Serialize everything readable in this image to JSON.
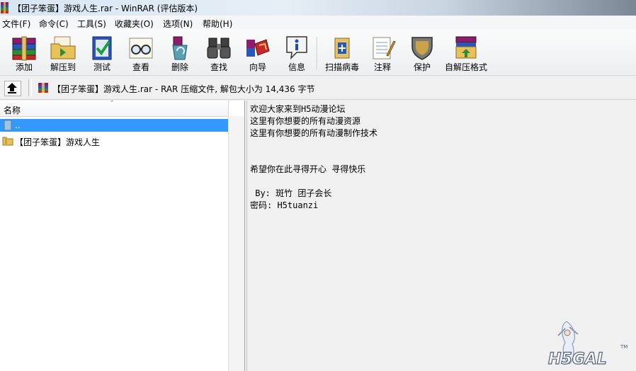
{
  "window": {
    "title": "【团子笨蛋】游戏人生.rar - WinRAR (评估版本)"
  },
  "menu": [
    "文件(F)",
    "命令(C)",
    "工具(S)",
    "收藏夹(O)",
    "选项(N)",
    "帮助(H)"
  ],
  "toolbar": {
    "add": "添加",
    "extract_to": "解压到",
    "test": "测试",
    "view": "查看",
    "delete": "删除",
    "find": "查找",
    "wizard": "向导",
    "info": "信息",
    "virus_scan": "扫描病毒",
    "comment": "注释",
    "protect": "保护",
    "sfx": "自解压格式"
  },
  "address": {
    "text": "【团子笨蛋】游戏人生.rar - RAR 压缩文件, 解包大小为 14,436 字节"
  },
  "file_list": {
    "column_name": "名称",
    "sort_indicator": "˄",
    "rows": [
      {
        "name": "..",
        "selected": true
      },
      {
        "name": "【团子笨蛋】游戏人生",
        "selected": false
      }
    ]
  },
  "comment": {
    "lines": [
      "欢迎大家来到H5动漫论坛",
      "这里有你想要的所有动漫资源",
      "这里有你想要的所有动漫制作技术",
      "希望你在此寻得开心 寻得快乐",
      " By: 斑竹 团子会长",
      "密码: H5tuanzi"
    ]
  },
  "watermark": {
    "text": "H5GAL",
    "mark": "TM"
  },
  "colors": {
    "selection": "#3399ff",
    "toolbar_bg": "#f3f4f5"
  }
}
